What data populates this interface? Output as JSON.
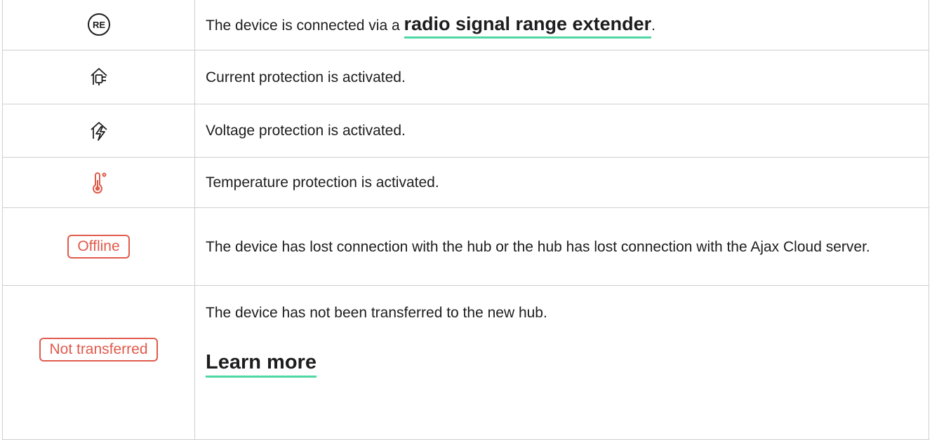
{
  "rows": {
    "re": {
      "icon_name": "radio-extender-icon",
      "icon_text": "RE",
      "desc_before": "The device is connected via a ",
      "link": "radio signal range extender",
      "desc_after": "."
    },
    "current": {
      "icon_name": "current-protection-icon",
      "desc": "Current protection is activated."
    },
    "voltage": {
      "icon_name": "voltage-protection-icon",
      "desc": "Voltage protection is activated."
    },
    "temperature": {
      "icon_name": "temperature-protection-icon",
      "desc": "Temperature protection is activated."
    },
    "offline": {
      "badge": "Offline",
      "desc": "The device has lost connection with the hub or the hub has lost connection with the Ajax Cloud server."
    },
    "not_transferred": {
      "badge": "Not transferred",
      "desc": "The device has not been transferred to the new hub.",
      "link": "Learn more"
    }
  },
  "colors": {
    "alert": "#e05a4c",
    "link_underline": "#4fd8a4",
    "border": "#cfcfcf"
  }
}
